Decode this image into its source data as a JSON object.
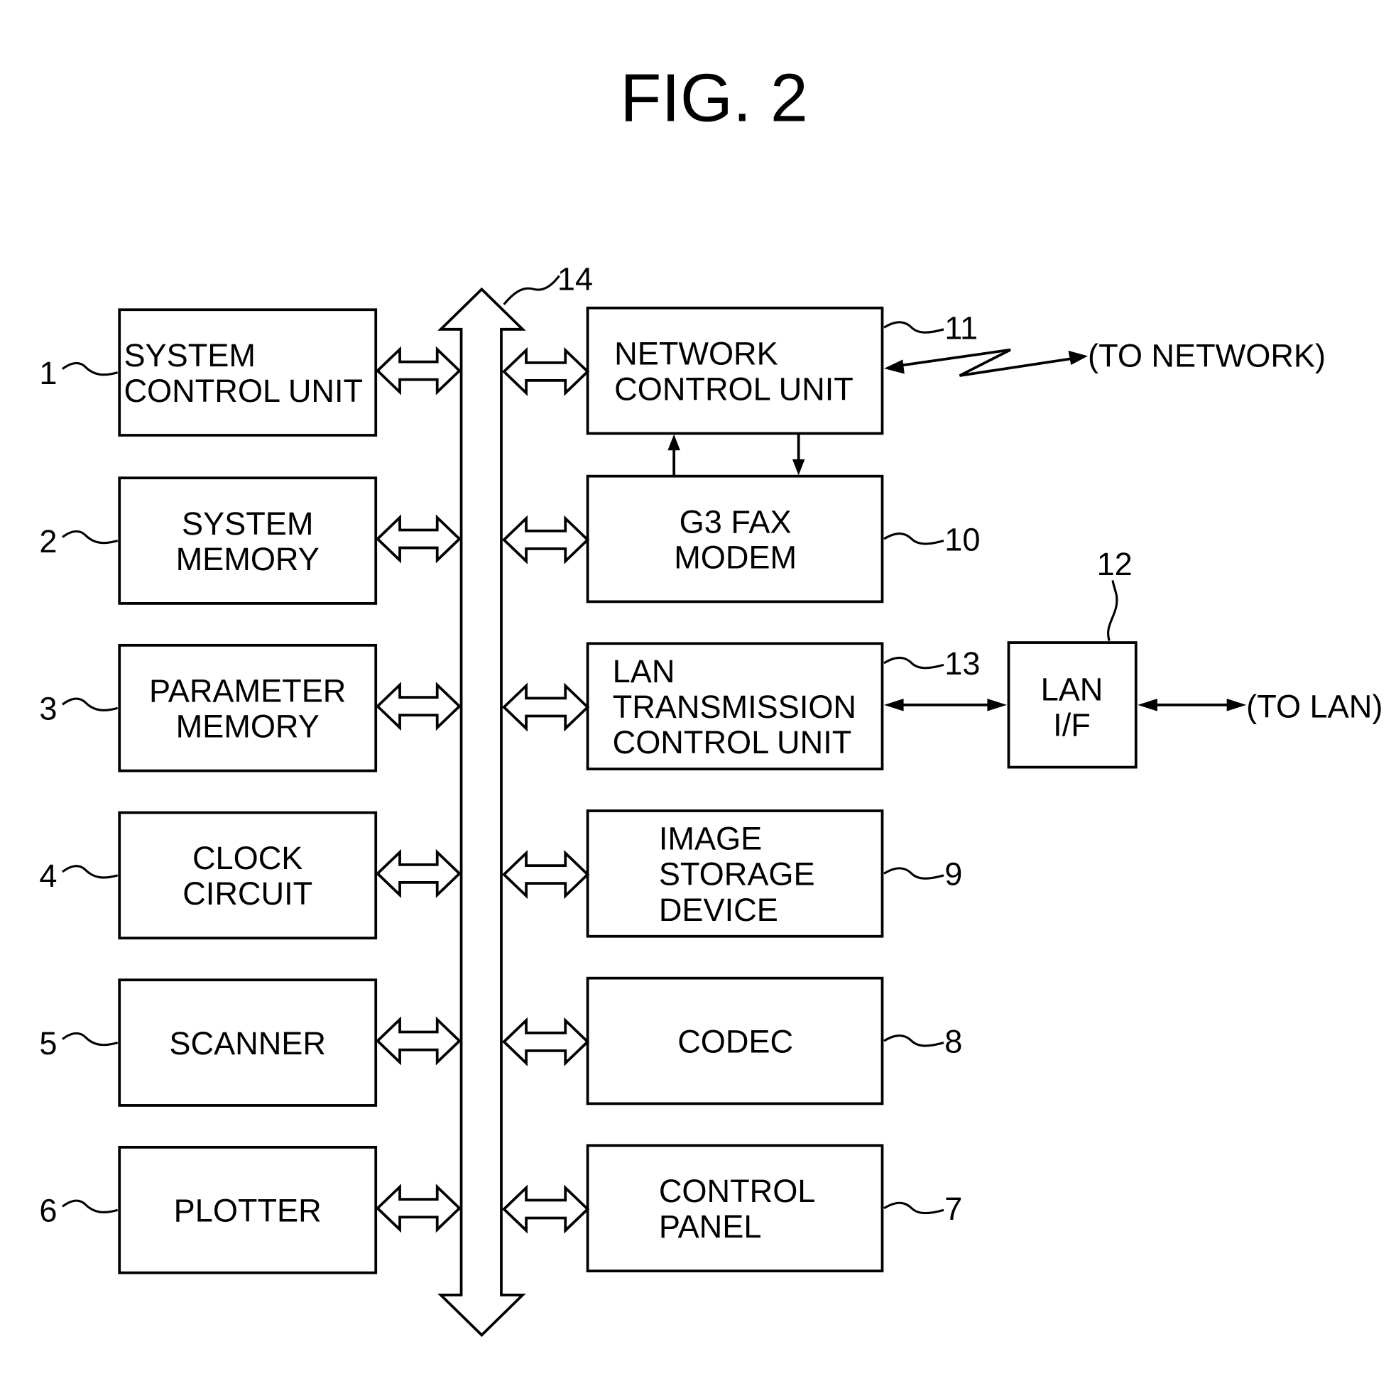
{
  "figure": {
    "title": "FIG. 2",
    "bus": {
      "ref": "14"
    },
    "left_blocks": [
      {
        "ref": "1",
        "lines": [
          "SYSTEM",
          "CONTROL UNIT"
        ]
      },
      {
        "ref": "2",
        "lines": [
          "SYSTEM",
          "MEMORY"
        ]
      },
      {
        "ref": "3",
        "lines": [
          "PARAMETER",
          "MEMORY"
        ]
      },
      {
        "ref": "4",
        "lines": [
          "CLOCK",
          "CIRCUIT"
        ]
      },
      {
        "ref": "5",
        "lines": [
          "SCANNER"
        ]
      },
      {
        "ref": "6",
        "lines": [
          "PLOTTER"
        ]
      }
    ],
    "right_blocks": [
      {
        "ref": "11",
        "lines": [
          "NETWORK",
          "CONTROL UNIT"
        ]
      },
      {
        "ref": "10",
        "lines": [
          "G3 FAX",
          "MODEM"
        ]
      },
      {
        "ref": "13",
        "lines": [
          "LAN",
          "TRANSMISSION",
          "CONTROL UNIT"
        ]
      },
      {
        "ref": "9",
        "lines": [
          "IMAGE",
          "STORAGE",
          "DEVICE"
        ]
      },
      {
        "ref": "8",
        "lines": [
          "CODEC"
        ]
      },
      {
        "ref": "7",
        "lines": [
          "CONTROL",
          "PANEL"
        ]
      }
    ],
    "lan_if": {
      "ref": "12",
      "lines": [
        "LAN",
        "I/F"
      ]
    },
    "external": {
      "network": "(TO NETWORK)",
      "lan": "(TO LAN)"
    }
  }
}
